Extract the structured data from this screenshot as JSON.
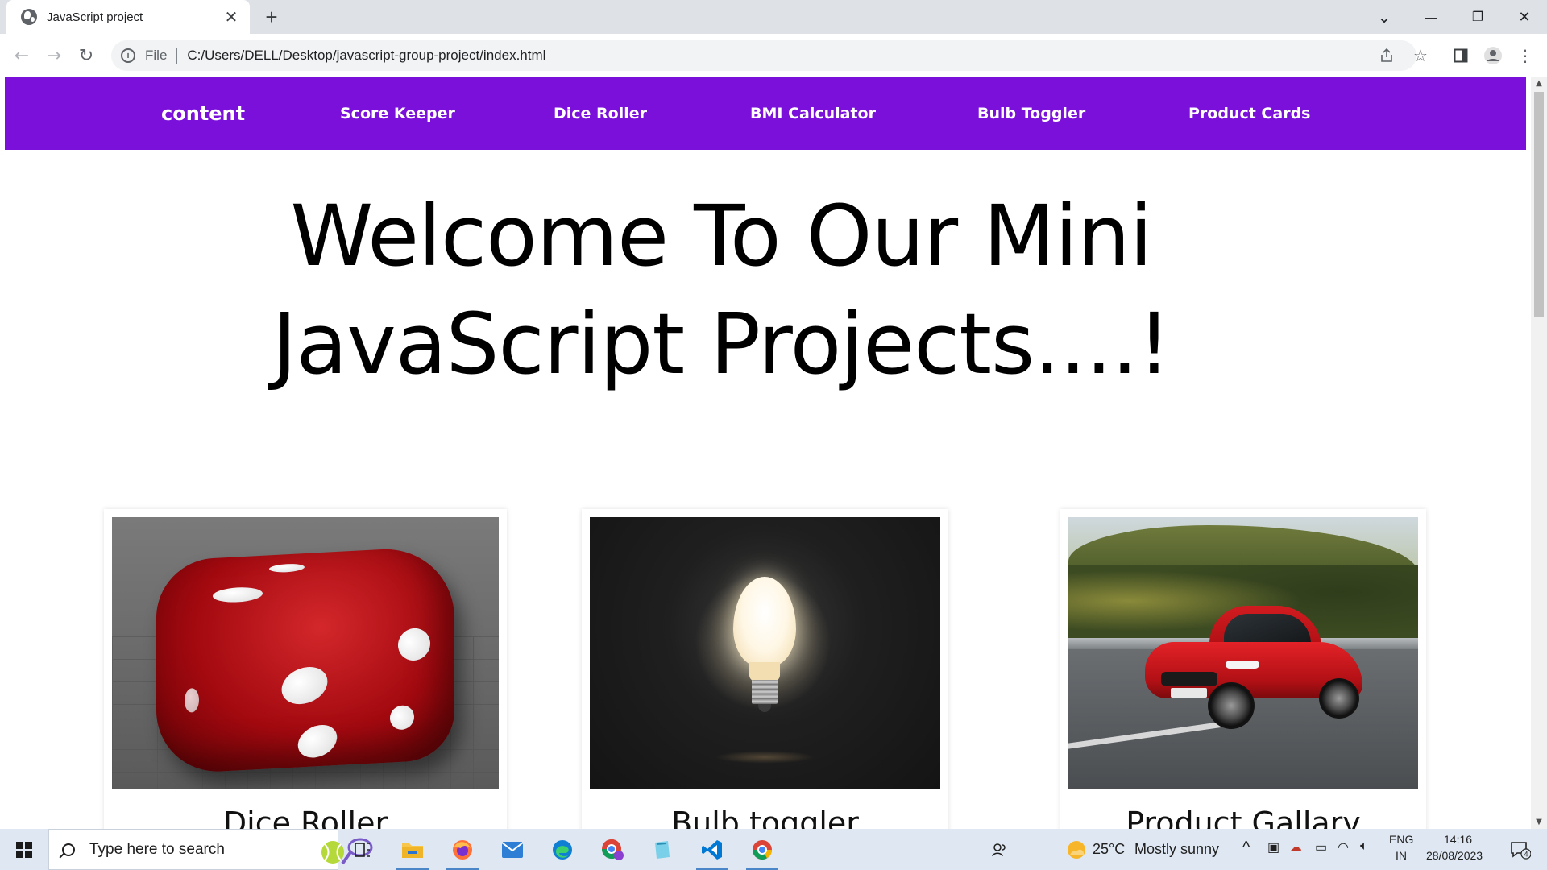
{
  "browser": {
    "tab_title": "JavaScript project",
    "tab_close": "✕",
    "new_tab": "+",
    "scheme_label": "File",
    "url": "C:/Users/DELL/Desktop/javascript-group-project/index.html",
    "window_controls": {
      "tablist": "⌄",
      "minimize": "—",
      "restore": "❐",
      "close": "✕"
    }
  },
  "navbar": {
    "brand": "content",
    "links": [
      "Score Keeper",
      "Dice Roller",
      "BMI Calculator",
      "Bulb Toggler",
      "Product Cards"
    ],
    "background": "#7a10d9"
  },
  "hero": {
    "line1": "Welcome To Our Mini",
    "line2": "JavaScript Projects....!"
  },
  "cards": [
    {
      "title": "Dice Roller",
      "image": "red-dice"
    },
    {
      "title": "Bulb toggler",
      "image": "light-bulb"
    },
    {
      "title": "Product Gallary",
      "image": "red-car"
    }
  ],
  "taskbar": {
    "search_placeholder": "Type here to search",
    "weather_temp": "25°C",
    "weather_desc": "Mostly sunny",
    "lang_top": "ENG",
    "lang_bottom": "IN",
    "time": "14:16",
    "date": "28/08/2023",
    "notification_count": "4"
  }
}
